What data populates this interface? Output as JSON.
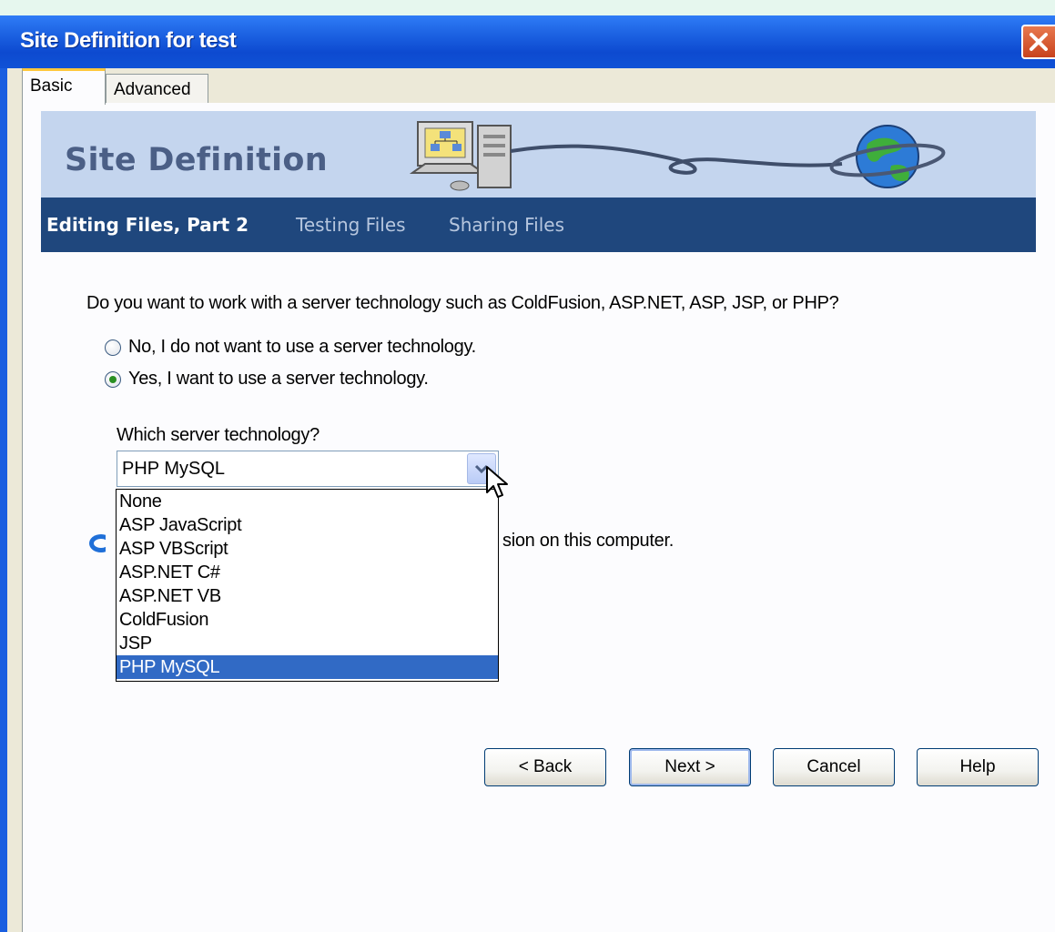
{
  "window": {
    "title": "Site Definition for test"
  },
  "tabs": [
    {
      "label": "Basic",
      "active": true
    },
    {
      "label": "Advanced",
      "active": false
    }
  ],
  "banner": {
    "title": "Site Definition"
  },
  "steps": {
    "current": "Editing Files, Part 2",
    "next1": "Testing Files",
    "next2": "Sharing Files"
  },
  "question": "Do you want to work with a server technology such as ColdFusion, ASP.NET, ASP, JSP, or PHP?",
  "radio_options": [
    {
      "label": "No, I do not want to use a server technology.",
      "selected": false
    },
    {
      "label": "Yes, I want to use a server technology.",
      "selected": true
    }
  ],
  "server_tech": {
    "label": "Which server technology?",
    "value": "PHP MySQL",
    "options": [
      "None",
      "ASP JavaScript",
      "ASP VBScript",
      "ASP.NET C#",
      "ASP.NET VB",
      "ColdFusion",
      "JSP",
      "PHP MySQL"
    ]
  },
  "hidden_option_fragment": "sion on this computer.",
  "buttons": {
    "back": "< Back",
    "next": "Next >",
    "cancel": "Cancel",
    "help": "Help"
  },
  "colors": {
    "title_bar": "#1a5fe0",
    "steps_bar": "#1f477d",
    "banner": "#c4d5ee",
    "selection": "#316ac5"
  }
}
